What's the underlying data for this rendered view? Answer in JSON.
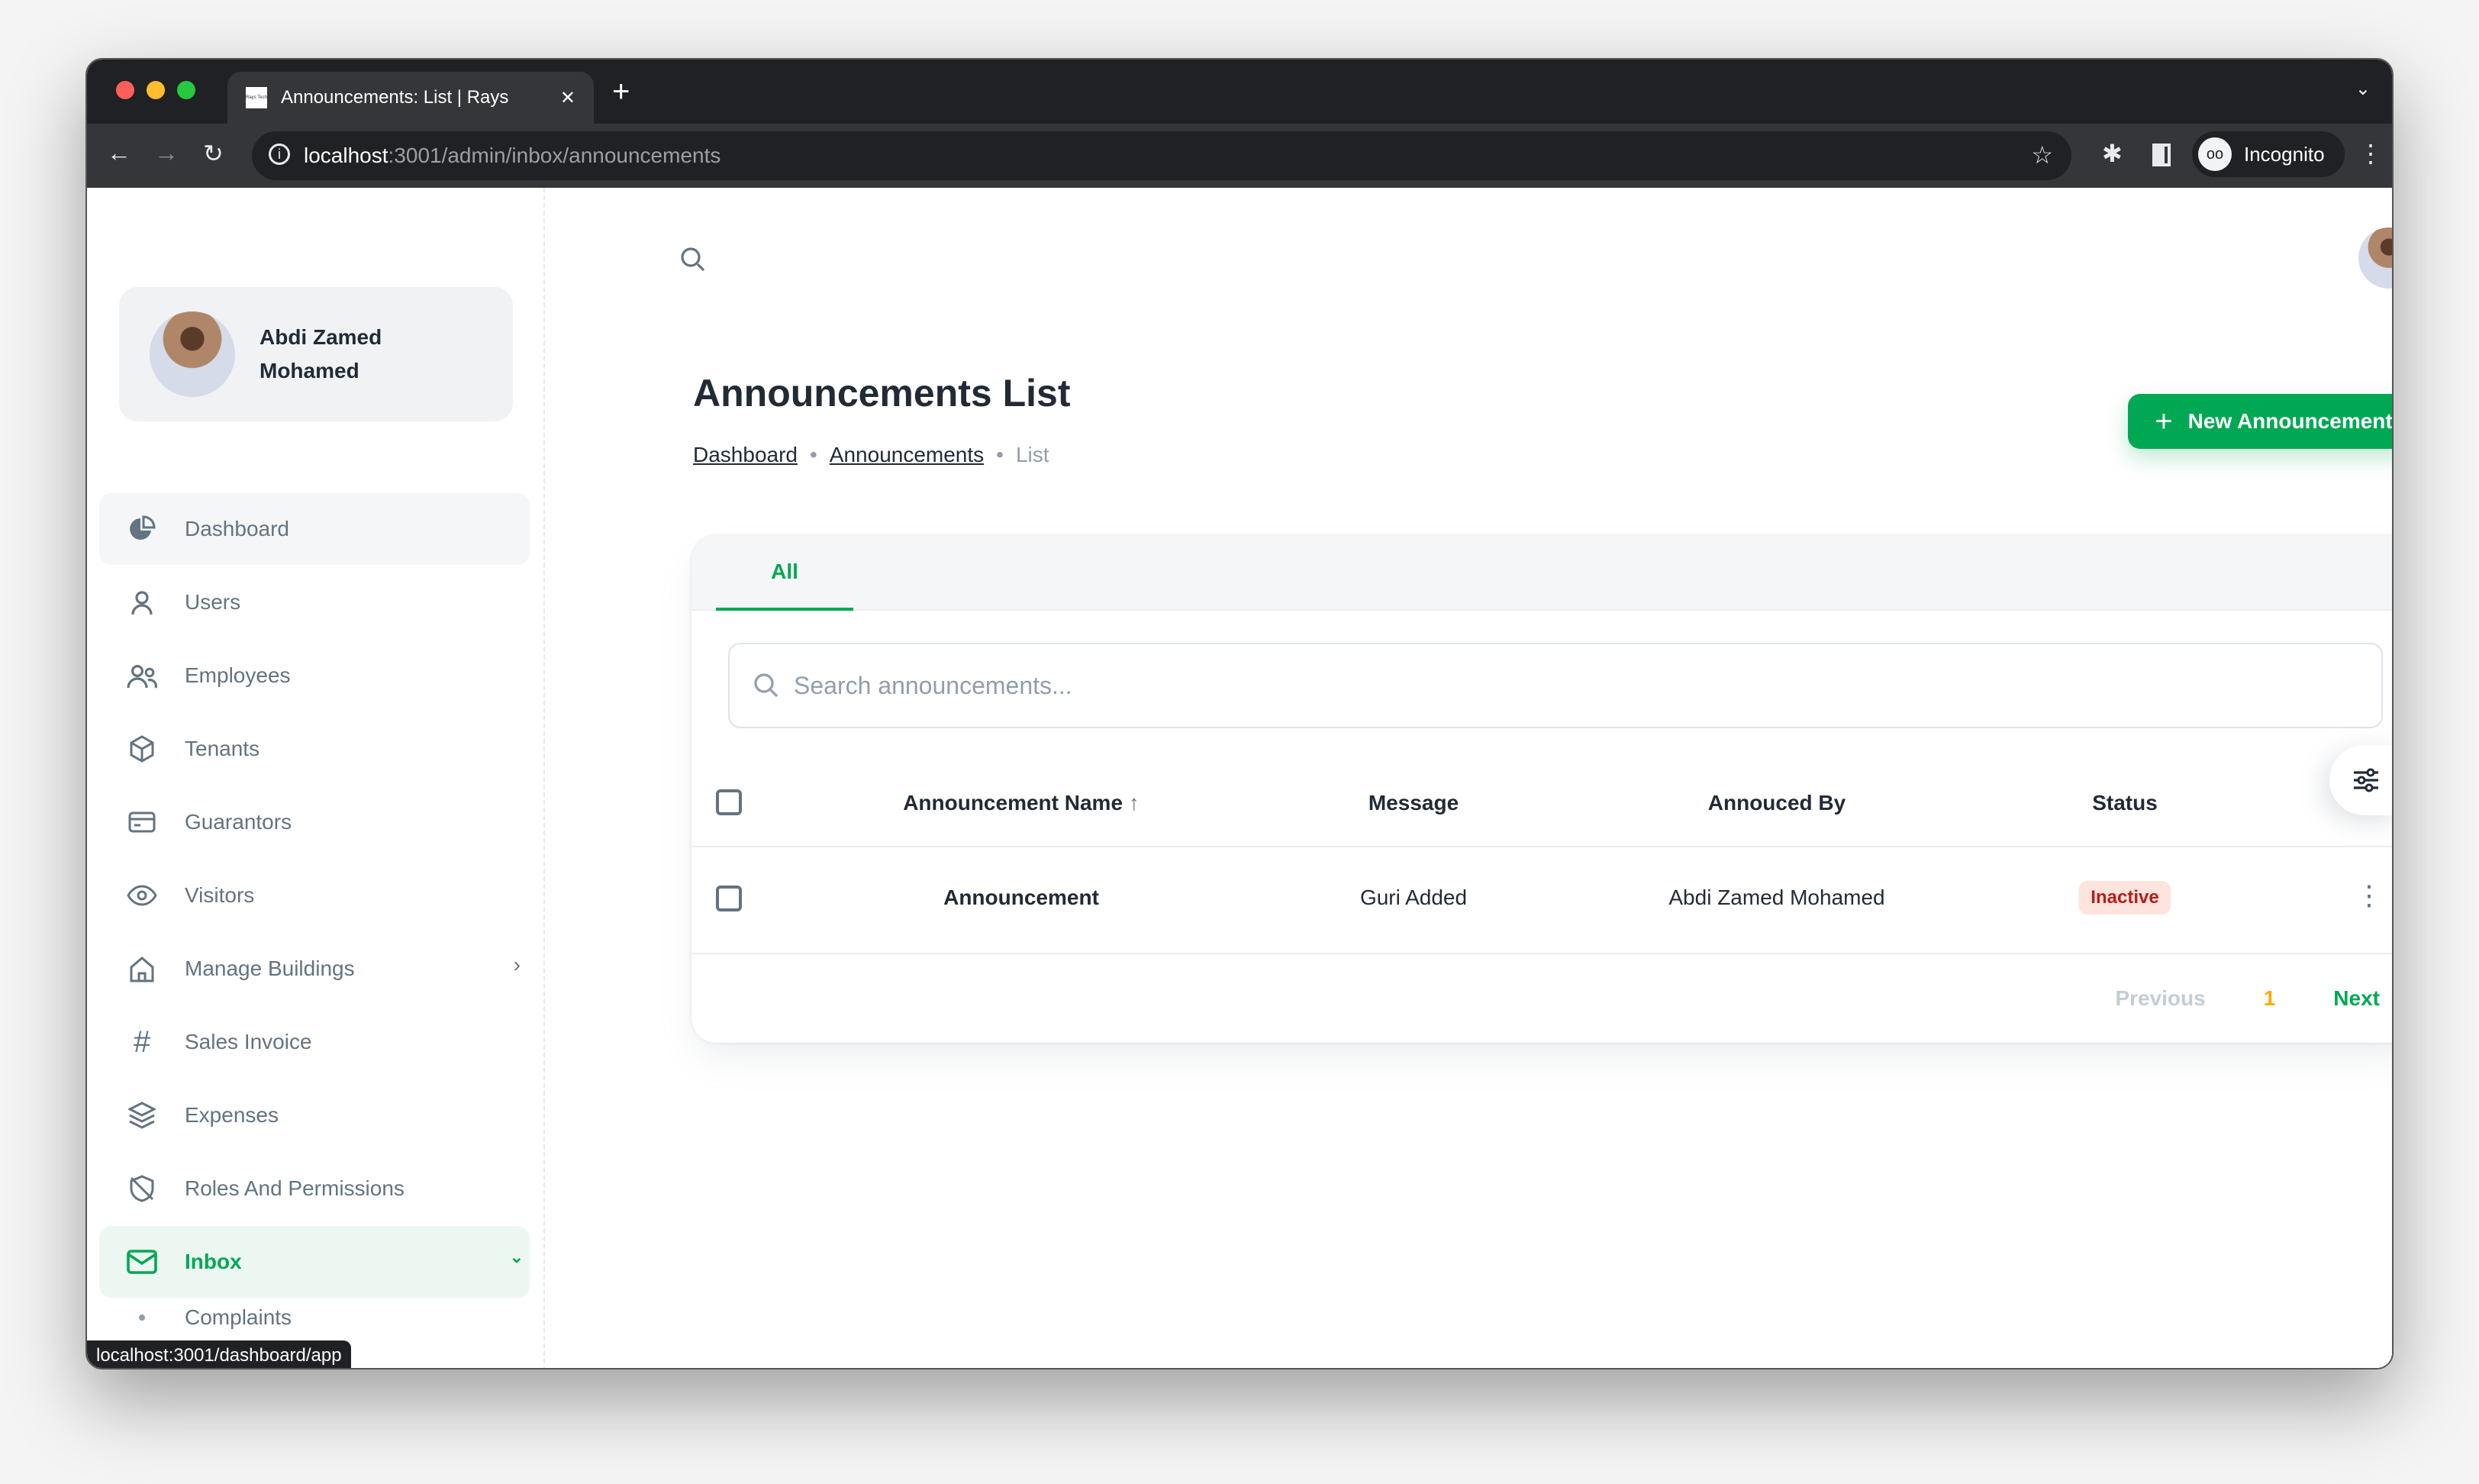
{
  "browser": {
    "tab_title": "Announcements: List | Rays",
    "favicon_text": "Rays Tech",
    "url_host": "localhost",
    "url_path": ":3001/admin/inbox/announcements",
    "profile": "Incognito",
    "status_url": "localhost:3001/dashboard/app"
  },
  "user": {
    "name_line1": "Abdi Zamed",
    "name_line2": "Mohamed"
  },
  "sidebar": {
    "items": [
      {
        "label": "Dashboard",
        "icon": "pie-chart-icon"
      },
      {
        "label": "Users",
        "icon": "user-icon"
      },
      {
        "label": "Employees",
        "icon": "users-icon"
      },
      {
        "label": "Tenants",
        "icon": "cube-icon"
      },
      {
        "label": "Guarantors",
        "icon": "card-icon"
      },
      {
        "label": "Visitors",
        "icon": "eye-icon"
      },
      {
        "label": "Manage Buildings",
        "icon": "home-icon"
      },
      {
        "label": "Sales Invoice",
        "icon": "hash-icon"
      },
      {
        "label": "Expenses",
        "icon": "layers-icon"
      },
      {
        "label": "Roles And Permissions",
        "icon": "shield-off-icon"
      },
      {
        "label": "Inbox",
        "icon": "mail-icon"
      },
      {
        "label": "Complaints",
        "icon": "dot-icon"
      }
    ]
  },
  "page": {
    "title": "Announcements List",
    "breadcrumb": [
      "Dashboard",
      "Announcements",
      "List"
    ],
    "new_button": "New Announcement"
  },
  "tabs": [
    {
      "label": "All"
    }
  ],
  "search": {
    "placeholder": "Search announcements..."
  },
  "table": {
    "columns": [
      "Announcement Name",
      "Message",
      "Annouced By",
      "Status"
    ],
    "rows": [
      {
        "name": "Announcement",
        "message": "Guri Added",
        "by": "Abdi Zamed Mohamed",
        "status": "Inactive"
      }
    ]
  },
  "pagination": {
    "previous": "Previous",
    "page": "1",
    "next": "Next"
  },
  "colors": {
    "accent": "#00a854",
    "inactive_bg": "#ffe4de",
    "inactive_text": "#b71d18",
    "page_number": "#ffab00"
  }
}
